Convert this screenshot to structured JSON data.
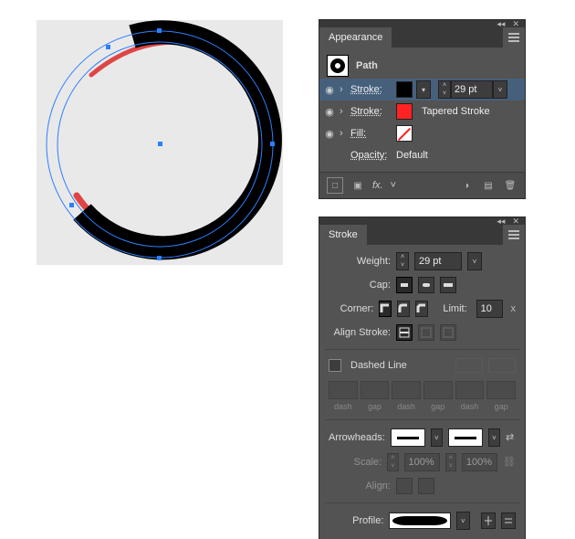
{
  "appearance": {
    "title": "Appearance",
    "object": "Path",
    "rows": [
      {
        "label": "Stroke:",
        "value": "29 pt",
        "kind": "black",
        "extra": ""
      },
      {
        "label": "Stroke:",
        "value": "",
        "kind": "red",
        "extra": "Tapered Stroke"
      },
      {
        "label": "Fill:",
        "value": "",
        "kind": "none",
        "extra": ""
      }
    ],
    "opacity_label": "Opacity:",
    "opacity_value": "Default",
    "fx": "fx."
  },
  "stroke": {
    "title": "Stroke",
    "weight_label": "Weight:",
    "weight_value": "29 pt",
    "cap_label": "Cap:",
    "corner_label": "Corner:",
    "limit_label": "Limit:",
    "limit_value": "10",
    "align_label": "Align Stroke:",
    "dashed_label": "Dashed Line",
    "dash_word": "dash",
    "gap_word": "gap",
    "arrow_label": "Arrowheads:",
    "scale_label": "Scale:",
    "scale_value": "100%",
    "align_arrow": "Align:",
    "profile_label": "Profile:",
    "x": "x"
  },
  "icons": {
    "collapse": "◂◂",
    "close": "✕"
  }
}
